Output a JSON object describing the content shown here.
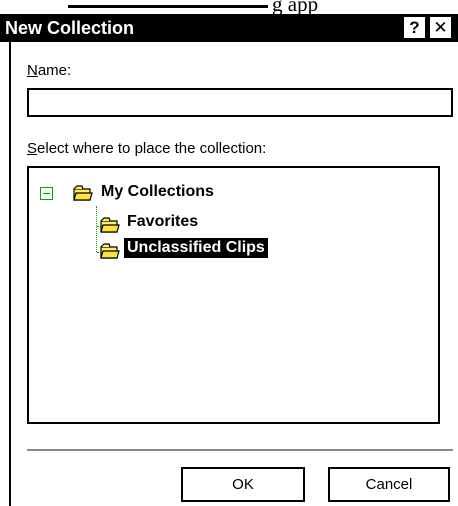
{
  "background": {
    "fragment_text": "g  app"
  },
  "dialog": {
    "title": "New Collection",
    "help_glyph": "?",
    "close_glyph": "✕"
  },
  "name": {
    "label_accel": "N",
    "label_rest": "ame:",
    "value": "",
    "placeholder": ""
  },
  "place": {
    "label_accel": "S",
    "label_rest": "elect where to place the collection:"
  },
  "tree": {
    "root": {
      "label": "My Collections",
      "icon": "folder-icon",
      "expanded": true
    },
    "children": [
      {
        "label": "Favorites",
        "icon": "folder-icon",
        "selected": false
      },
      {
        "label": "Unclassified Clips",
        "icon": "folder-icon",
        "selected": true
      }
    ]
  },
  "buttons": {
    "ok": "OK",
    "cancel": "Cancel"
  },
  "colors": {
    "folder_fill": "#ffee66",
    "folder_stroke": "#000000",
    "tree_line": "#00aa00",
    "selection": "#000000"
  }
}
